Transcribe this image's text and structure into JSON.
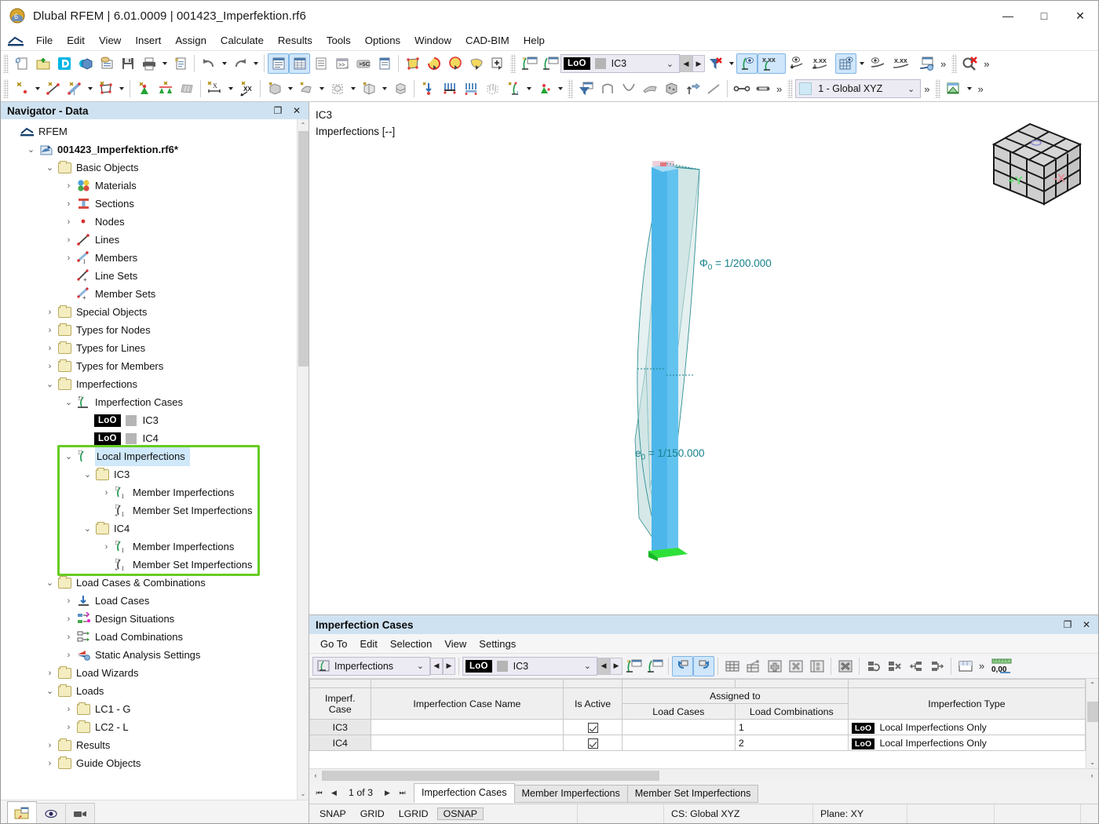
{
  "window": {
    "title": "Dlubal RFEM | 6.01.0009 | 001423_Imperfektion.rf6",
    "app_icon": "rfem-app-icon",
    "minimize": "—",
    "maximize": "□",
    "close": "✕"
  },
  "menubar": {
    "items": [
      "File",
      "Edit",
      "View",
      "Insert",
      "Assign",
      "Calculate",
      "Results",
      "Tools",
      "Options",
      "Window",
      "CAD-BIM",
      "Help"
    ]
  },
  "toolbar": {
    "imperfection_case_selector": {
      "badge": "LoO",
      "value": "IC3",
      "dropdown_arrow": "⌄",
      "prev": "◀",
      "next": "▶"
    },
    "coordinate_system": {
      "value": "1 - Global XYZ",
      "dropdown_arrow": "⌄"
    },
    "overflow": "»"
  },
  "navigator": {
    "title": "Navigator - Data",
    "restore_glyph": "❐",
    "close_glyph": "✕",
    "scroll_up": "⌃",
    "scroll_down": "⌄",
    "tree": [
      {
        "depth": 0,
        "expander": "",
        "icon": "rfem-root-icon",
        "label": "RFEM"
      },
      {
        "depth": 1,
        "expander": "⌄",
        "icon": "model-file-icon",
        "label": "001423_Imperfektion.rf6*",
        "bold": true
      },
      {
        "depth": 2,
        "expander": "⌄",
        "icon": "folder-icon",
        "label": "Basic Objects"
      },
      {
        "depth": 3,
        "expander": "›",
        "icon": "materials-icon",
        "label": "Materials"
      },
      {
        "depth": 3,
        "expander": "›",
        "icon": "sections-icon",
        "label": "Sections"
      },
      {
        "depth": 3,
        "expander": "›",
        "icon": "nodes-icon",
        "label": "Nodes"
      },
      {
        "depth": 3,
        "expander": "›",
        "icon": "lines-icon",
        "label": "Lines"
      },
      {
        "depth": 3,
        "expander": "›",
        "icon": "members-icon",
        "label": "Members"
      },
      {
        "depth": 3,
        "expander": "",
        "icon": "line-sets-icon",
        "label": "Line Sets"
      },
      {
        "depth": 3,
        "expander": "",
        "icon": "member-sets-icon",
        "label": "Member Sets"
      },
      {
        "depth": 2,
        "expander": "›",
        "icon": "folder-icon",
        "label": "Special Objects"
      },
      {
        "depth": 2,
        "expander": "›",
        "icon": "folder-icon",
        "label": "Types for Nodes"
      },
      {
        "depth": 2,
        "expander": "›",
        "icon": "folder-icon",
        "label": "Types for Lines"
      },
      {
        "depth": 2,
        "expander": "›",
        "icon": "folder-icon",
        "label": "Types for Members"
      },
      {
        "depth": 2,
        "expander": "⌄",
        "icon": "folder-icon",
        "label": "Imperfections"
      },
      {
        "depth": 3,
        "expander": "⌄",
        "icon": "imperfection-case-icon",
        "label": "Imperfection Cases"
      },
      {
        "depth": 4,
        "expander": "",
        "icon": "loo-badge-icon",
        "label": "IC3",
        "badge": "LoO"
      },
      {
        "depth": 4,
        "expander": "",
        "icon": "loo-badge-icon",
        "label": "IC4",
        "badge": "LoO"
      },
      {
        "depth": 3,
        "expander": "⌄",
        "icon": "local-imperfection-icon",
        "label": "Local Imperfections",
        "selected": true
      },
      {
        "depth": 4,
        "expander": "⌄",
        "icon": "folder-icon",
        "label": "IC3"
      },
      {
        "depth": 5,
        "expander": "›",
        "icon": "member-imperfection-icon",
        "label": "Member Imperfections"
      },
      {
        "depth": 5,
        "expander": "",
        "icon": "member-set-imperfection-icon",
        "label": "Member Set Imperfections"
      },
      {
        "depth": 4,
        "expander": "⌄",
        "icon": "folder-icon",
        "label": "IC4"
      },
      {
        "depth": 5,
        "expander": "›",
        "icon": "member-imperfection-icon",
        "label": "Member Imperfections"
      },
      {
        "depth": 5,
        "expander": "",
        "icon": "member-set-imperfection-icon",
        "label": "Member Set Imperfections"
      },
      {
        "depth": 2,
        "expander": "⌄",
        "icon": "folder-icon",
        "label": "Load Cases & Combinations"
      },
      {
        "depth": 3,
        "expander": "›",
        "icon": "load-cases-icon",
        "label": "Load Cases"
      },
      {
        "depth": 3,
        "expander": "›",
        "icon": "design-situations-icon",
        "label": "Design Situations"
      },
      {
        "depth": 3,
        "expander": "›",
        "icon": "load-combinations-icon",
        "label": "Load Combinations"
      },
      {
        "depth": 3,
        "expander": "›",
        "icon": "static-analysis-settings-icon",
        "label": "Static Analysis Settings"
      },
      {
        "depth": 2,
        "expander": "›",
        "icon": "folder-icon",
        "label": "Load Wizards"
      },
      {
        "depth": 2,
        "expander": "⌄",
        "icon": "folder-icon",
        "label": "Loads"
      },
      {
        "depth": 3,
        "expander": "›",
        "icon": "folder-icon",
        "label": "LC1 - G"
      },
      {
        "depth": 3,
        "expander": "›",
        "icon": "folder-icon",
        "label": "LC2 - L"
      },
      {
        "depth": 2,
        "expander": "›",
        "icon": "folder-icon",
        "label": "Results"
      },
      {
        "depth": 2,
        "expander": "›",
        "icon": "folder-icon",
        "label": "Guide Objects"
      }
    ],
    "tabs": [
      {
        "name": "data-tab",
        "icon": "data-navigator-icon",
        "active": true
      },
      {
        "name": "display-tab",
        "icon": "eye-icon",
        "active": false
      },
      {
        "name": "views-tab",
        "icon": "camera-icon",
        "active": false
      }
    ]
  },
  "viewport": {
    "case_label": "IC3",
    "sub_label": "Imperfections [--]",
    "annotations": [
      {
        "name": "phi0-annotation",
        "prefix": "Φ",
        "sub": "0",
        "text": " =  1/200.000"
      },
      {
        "name": "e0-annotation",
        "prefix": "e",
        "sub": "0",
        "text": " =  1/150.000"
      }
    ],
    "nav_cube": {
      "face_left": "+Y",
      "face_right": "-X"
    },
    "colors": {
      "member": "#4cb6ea",
      "imperfection_surface": "#cfe4e4",
      "annotation": "#17808c",
      "support": "#22dd33"
    }
  },
  "table_panel": {
    "title": "Imperfection Cases",
    "restore_glyph": "❐",
    "close_glyph": "✕",
    "menu": [
      "Go To",
      "Edit",
      "Selection",
      "View",
      "Settings"
    ],
    "object_selector": {
      "value": "Imperfections",
      "dropdown_arrow": "⌄",
      "prev": "◀",
      "next": "▶"
    },
    "case_selector": {
      "badge": "LoO",
      "value": "IC3",
      "dropdown_arrow": "⌄",
      "prev": "◀",
      "next": "▶"
    },
    "overflow": "»",
    "numeric_badge": "0,00",
    "grid": {
      "group_header": "Assigned to",
      "columns": [
        {
          "name": "imperf-case",
          "label_line1": "Imperf.",
          "label_line2": "Case"
        },
        {
          "name": "imperfection-case-name",
          "label_line1": "",
          "label_line2": "Imperfection Case Name"
        },
        {
          "name": "is-active",
          "label_line1": "",
          "label_line2": "Is Active"
        },
        {
          "name": "load-cases",
          "label_line1": "",
          "label_line2": "Load Cases"
        },
        {
          "name": "load-combinations",
          "label_line1": "",
          "label_line2": "Load Combinations"
        },
        {
          "name": "imperfection-type",
          "label_line1": "",
          "label_line2": "Imperfection Type"
        }
      ],
      "rows": [
        {
          "case": "IC3",
          "name": "",
          "active": true,
          "load_cases": "",
          "load_combinations": "1",
          "type_badge": "LoO",
          "type": "Local Imperfections Only"
        },
        {
          "case": "IC4",
          "name": "",
          "active": true,
          "load_cases": "",
          "load_combinations": "2",
          "type_badge": "LoO",
          "type": "Local Imperfections Only"
        }
      ]
    },
    "pager": {
      "first": "⏮",
      "prev": "◀",
      "label": "1 of 3",
      "next": "▶",
      "last": "⏭"
    },
    "tabs": [
      {
        "label": "Imperfection Cases",
        "active": true
      },
      {
        "label": "Member Imperfections",
        "active": false
      },
      {
        "label": "Member Set Imperfections",
        "active": false
      }
    ],
    "hscroll_left": "‹",
    "hscroll_right": "›",
    "vscroll_up": "⌃",
    "vscroll_down": "⌄"
  },
  "statusbar": {
    "toggles": [
      {
        "label": "SNAP",
        "on": false
      },
      {
        "label": "GRID",
        "on": false
      },
      {
        "label": "LGRID",
        "on": false
      },
      {
        "label": "OSNAP",
        "on": true
      }
    ],
    "cs": "CS: Global XYZ",
    "plane": "Plane: XY"
  }
}
